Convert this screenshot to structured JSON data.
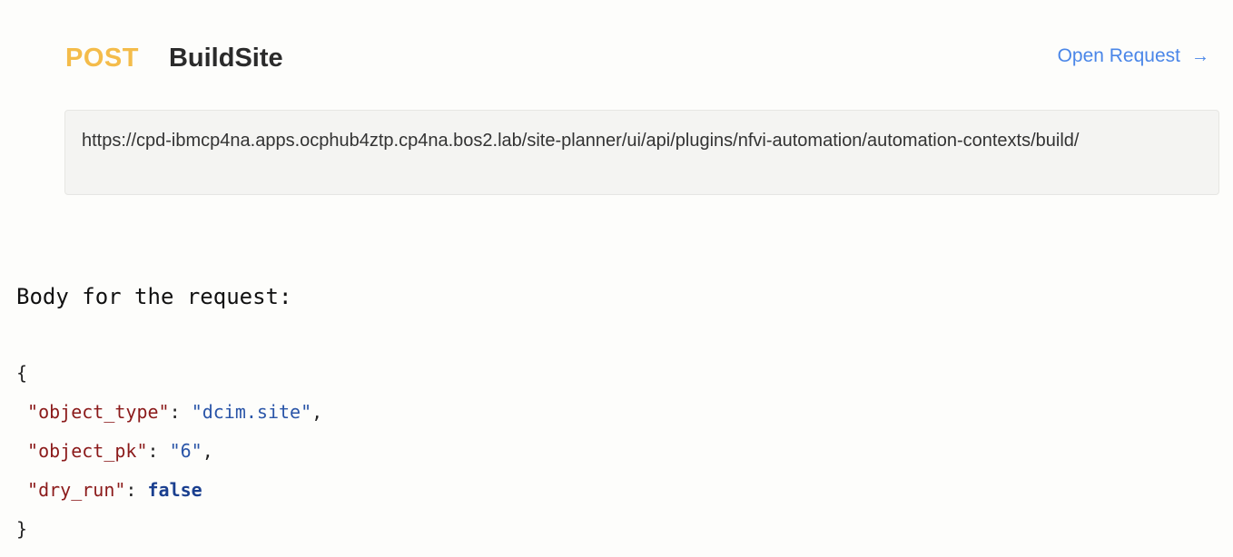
{
  "request": {
    "method": "POST",
    "name": "BuildSite",
    "open_label": "Open Request",
    "open_arrow": "→",
    "url": "https://cpd-ibmcp4na.apps.ocphub4ztp.cp4na.bos2.lab/site-planner/ui/api/plugins/nfvi-automation/automation-contexts/build/"
  },
  "colors": {
    "method": "#f4bc4a",
    "link": "#4a86e8",
    "json_key": "#8b1a1a",
    "json_string": "#2a55a8",
    "json_bool": "#1a3f8f"
  },
  "body": {
    "label": "Body for the request:",
    "open_brace": "{",
    "close_brace": "}",
    "fields": [
      {
        "key": "\"object_type\"",
        "value": "\"dcim.site\"",
        "value_type": "string",
        "trailing": ","
      },
      {
        "key": "\"object_pk\"",
        "value": "\"6\"",
        "value_type": "string",
        "trailing": ","
      },
      {
        "key": "\"dry_run\"",
        "value": "false",
        "value_type": "boolean",
        "trailing": ""
      }
    ]
  }
}
